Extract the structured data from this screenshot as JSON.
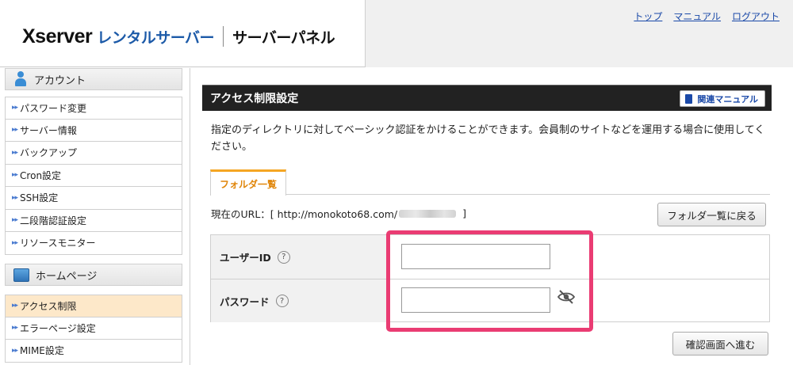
{
  "header": {
    "logo_brand": "Xserver",
    "logo_rental": "レンタルサーバー",
    "logo_panel": "サーバーパネル",
    "links": [
      "トップ",
      "マニュアル",
      "ログアウト"
    ]
  },
  "sidebar": {
    "account": {
      "title": "アカウント",
      "items": [
        "パスワード変更",
        "サーバー情報",
        "バックアップ",
        "Cron設定",
        "SSH設定",
        "二段階認証設定",
        "リソースモニター"
      ]
    },
    "homepage": {
      "title": "ホームページ",
      "items": [
        "アクセス制限",
        "エラーページ設定",
        "MIME設定"
      ],
      "active": "アクセス制限"
    }
  },
  "main": {
    "title": "アクセス制限設定",
    "manual_button": "関連マニュアル",
    "description": "指定のディレクトリに対してベーシック認証をかけることができます。会員制のサイトなどを運用する場合に使用してください。",
    "tab": "フォルダ一覧",
    "url_prefix": "現在のURL：[ http://monokoto68.com/",
    "url_suffix": "]",
    "back_button": "フォルダ一覧に戻る",
    "form": {
      "user_label": "ユーザーID",
      "user_value": "",
      "password_label": "パスワード",
      "password_value": ""
    },
    "confirm_button": "確認画面へ進む"
  },
  "colors": {
    "highlight": "#ea3c73",
    "tab_accent": "#f5a623",
    "link": "#1a49a8",
    "title_bar": "#222222"
  }
}
